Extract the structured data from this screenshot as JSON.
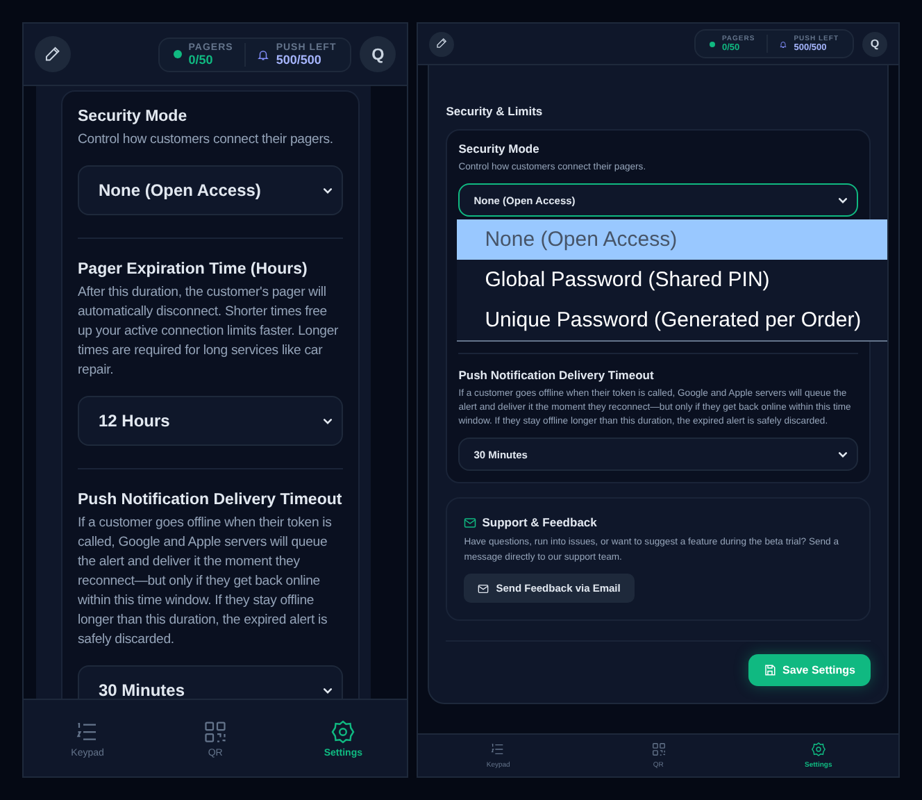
{
  "screens": [
    {
      "header": {
        "pagers_label": "PAGERS",
        "pagers_value": "0/50",
        "push_label": "PUSH LEFT",
        "push_value": "500/500",
        "search_button": "Q"
      },
      "fields": [
        {
          "label": "Security Mode",
          "description": "Control how customers connect their pagers.",
          "value": "None (Open Access)",
          "expanded": false
        },
        {
          "label": "Pager Expiration Time (Hours)",
          "description": "After this duration, the customer's pager will automatically disconnect. Shorter times free up your active connection limits faster. Longer times are required for long services like car repair.",
          "value": "12 Hours",
          "expanded": false
        },
        {
          "label": "Push Notification Delivery Timeout",
          "description": "If a customer goes offline when their token is called, Google and Apple servers will queue the alert and deliver it the moment they reconnect—but only if they get back online within this time window. If they stay offline longer than this duration, the expired alert is safely discarded.",
          "value": "30 Minutes",
          "expanded": false
        }
      ],
      "nav": [
        {
          "label": "Keypad",
          "selected": false
        },
        {
          "label": "QR",
          "selected": false
        },
        {
          "label": "Settings",
          "selected": true
        }
      ]
    },
    {
      "header": {
        "pagers_label": "PAGERS",
        "pagers_value": "0/50",
        "push_label": "PUSH LEFT",
        "push_value": "500/500",
        "search_button": "Q"
      },
      "section_title": "Security & Limits",
      "fields": [
        {
          "label": "Security Mode",
          "description": "Control how customers connect their pagers.",
          "value": "None (Open Access)",
          "expanded": true,
          "options": [
            {
              "label": "None (Open Access)",
              "selected": true
            },
            {
              "label": "Global Password (Shared PIN)",
              "selected": false
            },
            {
              "label": "Unique Password (Generated per Order)",
              "selected": false
            }
          ]
        },
        {
          "label": "Push Notification Delivery Timeout",
          "description": "If a customer goes offline when their token is called, Google and Apple servers will queue the alert and deliver it the moment they reconnect—but only if they get back online within this time window. If they stay offline longer than this duration, the expired alert is safely discarded.",
          "value": "30 Minutes",
          "expanded": false
        }
      ],
      "support": {
        "title": "Support & Feedback",
        "text": "Have questions, run into issues, or want to suggest a feature during the beta trial? Send a message directly to our support team.",
        "button": "Send Feedback via Email"
      },
      "save_button": "Save Settings",
      "nav": [
        {
          "label": "Keypad",
          "selected": false
        },
        {
          "label": "QR",
          "selected": false
        },
        {
          "label": "Settings",
          "selected": true
        }
      ]
    }
  ]
}
